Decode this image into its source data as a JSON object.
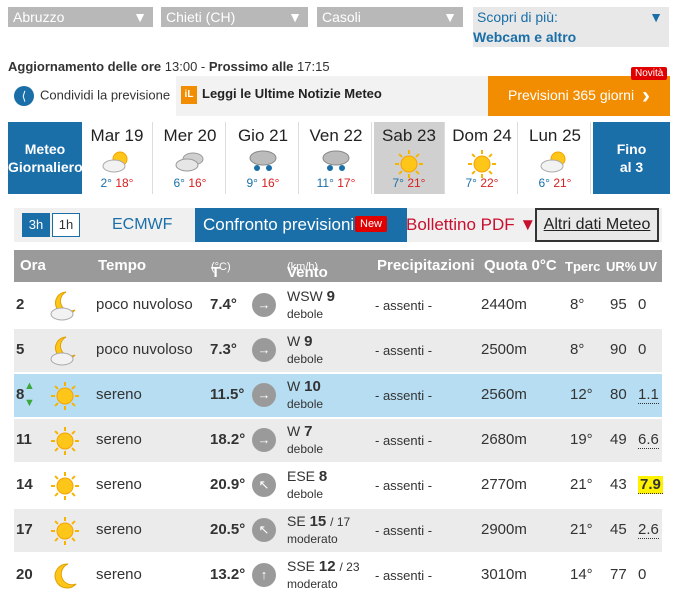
{
  "selects": {
    "region": "Abruzzo",
    "province": "Chieti (CH)",
    "town": "Casoli"
  },
  "discover": {
    "label": "Scopri di più:",
    "link": "Webcam e altro"
  },
  "update": {
    "prefix": "Aggiornamento delle ore",
    "time": "13:00",
    "sep": " - ",
    "next_prefix": "Prossimo alle",
    "next_time": "17:15"
  },
  "share_label": "Condividi la previsione",
  "news_label": "Leggi le Ultime Notizie Meteo",
  "f365_label": "Previsioni 365 giorni",
  "novita_label": "Novità",
  "daily": {
    "label1": "Meteo",
    "label2": "Giornaliero"
  },
  "fino": {
    "label1": "Fino",
    "label2": "al 3"
  },
  "days": [
    {
      "name": "Mar 19",
      "min": "2°",
      "max": "18°",
      "icon": "partly-cloudy-icon"
    },
    {
      "name": "Mer 20",
      "min": "6°",
      "max": "16°",
      "icon": "cloudy-icon"
    },
    {
      "name": "Gio 21",
      "min": "9°",
      "max": "16°",
      "icon": "cloud-rain-icon"
    },
    {
      "name": "Ven 22",
      "min": "11°",
      "max": "17°",
      "icon": "cloud-rain-icon"
    },
    {
      "name": "Sab 23",
      "min": "7°",
      "max": "21°",
      "icon": "sun-icon"
    },
    {
      "name": "Dom 24",
      "min": "7°",
      "max": "22°",
      "icon": "sun-icon"
    },
    {
      "name": "Lun 25",
      "min": "6°",
      "max": "21°",
      "icon": "partly-cloudy-icon"
    }
  ],
  "controls": {
    "t3h": "3h",
    "t1h": "1h",
    "model": "ECMWF",
    "compare": "Confronto previsioni",
    "new": "New",
    "bulletin": "Bollettino PDF ▼",
    "more": "Altri dati Meteo"
  },
  "headers": {
    "ora": "Ora",
    "tempo": "Tempo",
    "t": "T",
    "t_unit": "(°C)",
    "vento": "Vento",
    "vento_unit": "(km/h)",
    "prec": "Precipitazioni",
    "quota": "Quota 0°C",
    "tperc": "Tperc",
    "ur": "UR%",
    "uv": "UV"
  },
  "rows": [
    {
      "hour": "2",
      "desc": "poco nuvoloso",
      "temp": "7.4°",
      "wdir": "WSW",
      "wspd": "9",
      "gust": "",
      "wq": "debole",
      "prec": "- assenti -",
      "quota": "2440m",
      "tperc": "8°",
      "ur": "95",
      "uv": "0",
      "icon": "moon-cloud-icon"
    },
    {
      "hour": "5",
      "desc": "poco nuvoloso",
      "temp": "7.3°",
      "wdir": "W",
      "wspd": "9",
      "gust": "",
      "wq": "debole",
      "prec": "- assenti -",
      "quota": "2500m",
      "tperc": "8°",
      "ur": "90",
      "uv": "0",
      "icon": "moon-cloud-icon"
    },
    {
      "hour": "8",
      "desc": "sereno",
      "temp": "11.5°",
      "wdir": "W",
      "wspd": "10",
      "gust": "",
      "wq": "debole",
      "prec": "- assenti -",
      "quota": "2560m",
      "tperc": "12°",
      "ur": "80",
      "uv": "1.1",
      "icon": "sun-icon"
    },
    {
      "hour": "11",
      "desc": "sereno",
      "temp": "18.2°",
      "wdir": "W",
      "wspd": "7",
      "gust": "",
      "wq": "debole",
      "prec": "- assenti -",
      "quota": "2680m",
      "tperc": "19°",
      "ur": "49",
      "uv": "6.6",
      "icon": "sun-icon"
    },
    {
      "hour": "14",
      "desc": "sereno",
      "temp": "20.9°",
      "wdir": "ESE",
      "wspd": "8",
      "gust": "",
      "wq": "debole",
      "prec": "- assenti -",
      "quota": "2770m",
      "tperc": "21°",
      "ur": "43",
      "uv": "7.9",
      "icon": "sun-icon"
    },
    {
      "hour": "17",
      "desc": "sereno",
      "temp": "20.5°",
      "wdir": "SE",
      "wspd": "15",
      "gust": "/ 17",
      "wq": "moderato",
      "prec": "- assenti -",
      "quota": "2900m",
      "tperc": "21°",
      "ur": "45",
      "uv": "2.6",
      "icon": "sun-icon"
    },
    {
      "hour": "20",
      "desc": "sereno",
      "temp": "13.2°",
      "wdir": "SSE",
      "wspd": "12",
      "gust": "/ 23",
      "wq": "moderato",
      "prec": "- assenti -",
      "quota": "3010m",
      "tperc": "14°",
      "ur": "77",
      "uv": "0",
      "icon": "moon-icon"
    }
  ],
  "colors": {
    "accent": "#1a6fa8",
    "orange": "#f28c00",
    "red": "#e10000",
    "highlight": "#b6ddf2",
    "uv_high": "#fff200"
  }
}
